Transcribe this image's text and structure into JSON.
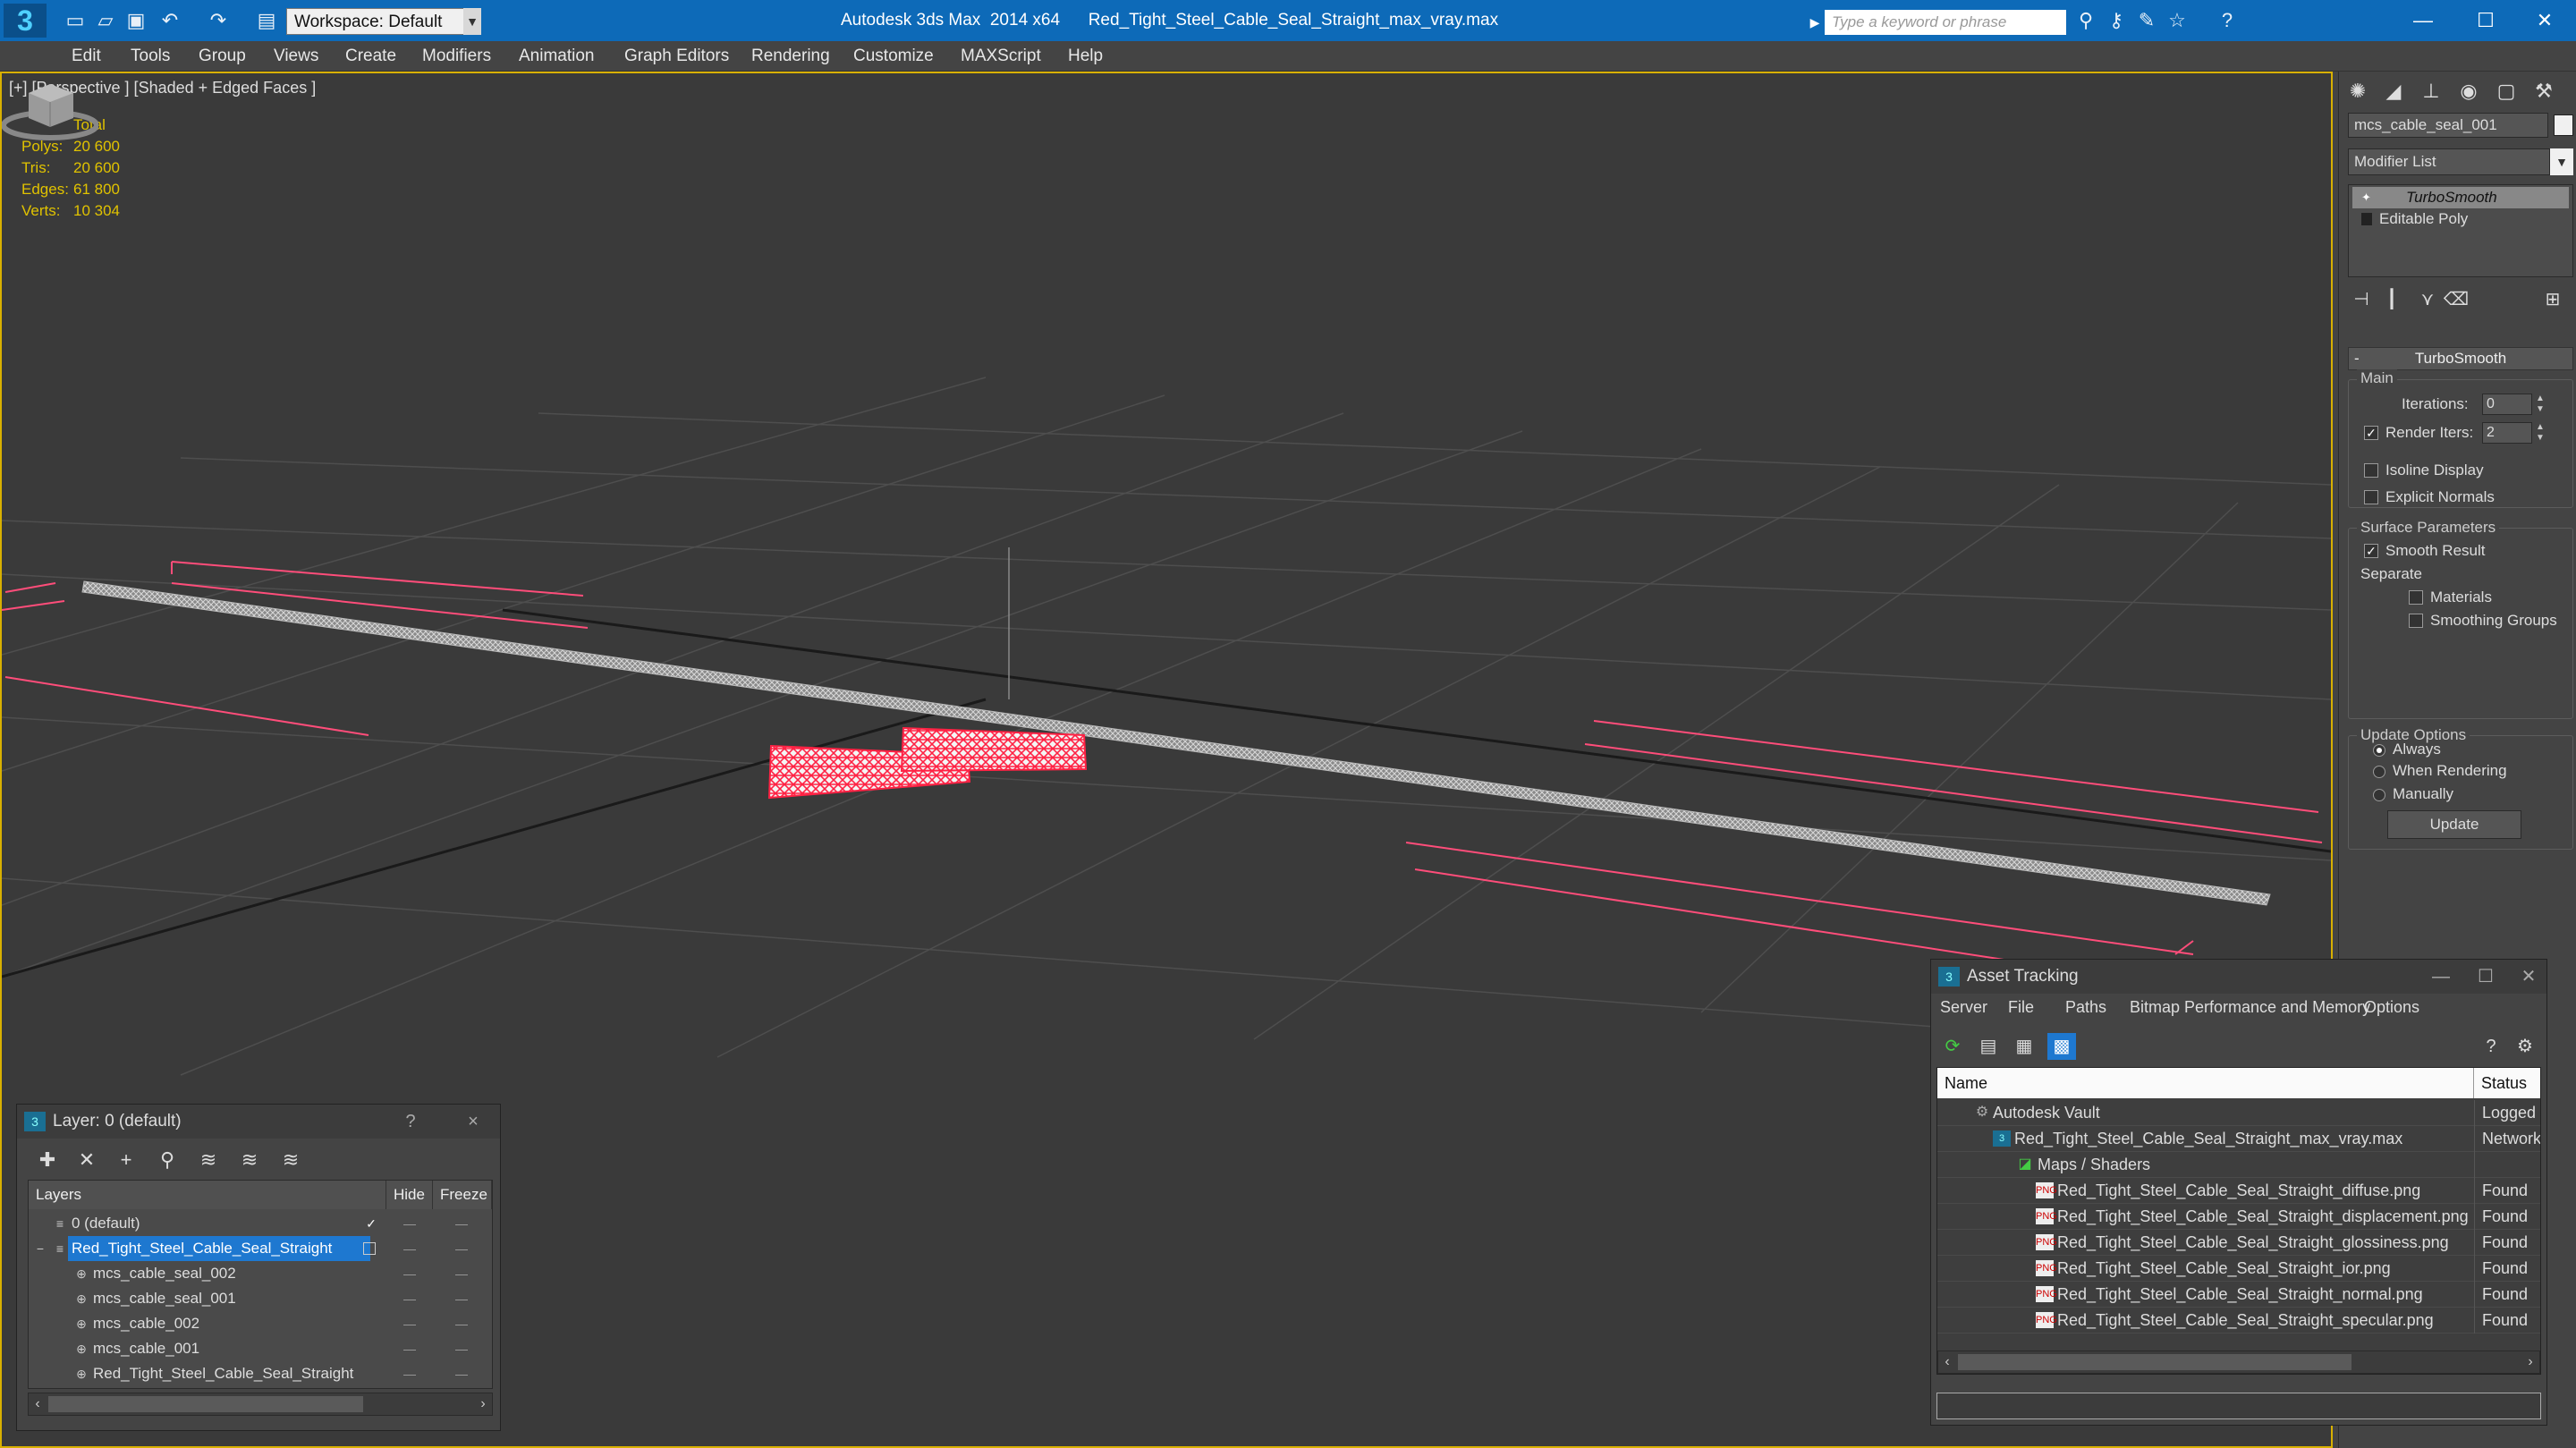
{
  "titlebar": {
    "app_title": "Autodesk 3ds Max  2014 x64      Red_Tight_Steel_Cable_Seal_Straight_max_vray.max",
    "workspace": "Workspace: Default",
    "search_placeholder": "Type a keyword or phrase",
    "logo": "3"
  },
  "menu": {
    "items": [
      "Edit",
      "Tools",
      "Group",
      "Views",
      "Create",
      "Modifiers",
      "Animation",
      "Graph Editors",
      "Rendering",
      "Customize",
      "MAXScript",
      "Help"
    ]
  },
  "viewport": {
    "label": "[+] [Perspective ] [Shaded + Edged Faces ]",
    "stats": {
      "header": "Total",
      "rows": [
        {
          "label": "Polys:",
          "value": "20 600"
        },
        {
          "label": "Tris:",
          "value": "20 600"
        },
        {
          "label": "Edges:",
          "value": "61 800"
        },
        {
          "label": "Verts:",
          "value": "10 304"
        }
      ]
    },
    "colors": {
      "selection": "#e0c200",
      "wire": "#ff3355",
      "grid": "#505050"
    }
  },
  "command_panel": {
    "object_name": "mcs_cable_seal_001",
    "modifier_list": "Modifier List",
    "stack": [
      "TurboSmooth",
      "Editable Poly"
    ],
    "rollout_title": "TurboSmooth",
    "main_group": "Main",
    "iterations_label": "Iterations:",
    "iterations_value": "0",
    "render_iters_label": "Render Iters:",
    "render_iters_value": "2",
    "render_iters_checked": true,
    "isoline_label": "Isoline Display",
    "explicit_normals_label": "Explicit Normals",
    "surface_group": "Surface Parameters",
    "smooth_result_label": "Smooth Result",
    "separate_label": "Separate",
    "materials_label": "Materials",
    "smoothing_groups_label": "Smoothing Groups",
    "update_group": "Update Options",
    "update_options": [
      "Always",
      "When Rendering",
      "Manually"
    ],
    "update_selected": "Always",
    "update_button": "Update"
  },
  "layer_dialog": {
    "title": "Layer: 0 (default)",
    "help": "?",
    "close": "×",
    "columns": {
      "layers": "Layers",
      "hide": "Hide",
      "freeze": "Freeze"
    },
    "rows": [
      {
        "name": "0 (default)",
        "indent": 0,
        "kind": "layer",
        "active": true
      },
      {
        "name": "Red_Tight_Steel_Cable_Seal_Straight",
        "indent": 0,
        "kind": "layer",
        "selected": true
      },
      {
        "name": "mcs_cable_seal_002",
        "indent": 1,
        "kind": "object"
      },
      {
        "name": "mcs_cable_seal_001",
        "indent": 1,
        "kind": "object"
      },
      {
        "name": "mcs_cable_002",
        "indent": 1,
        "kind": "object"
      },
      {
        "name": "mcs_cable_001",
        "indent": 1,
        "kind": "object"
      },
      {
        "name": "Red_Tight_Steel_Cable_Seal_Straight",
        "indent": 1,
        "kind": "object"
      }
    ]
  },
  "asset_dialog": {
    "title": "Asset Tracking",
    "menu": [
      "Server",
      "File",
      "Paths",
      "Bitmap Performance and Memory",
      "Options"
    ],
    "columns": {
      "name": "Name",
      "status": "Status"
    },
    "rows": [
      {
        "name": "Autodesk Vault",
        "indent": 1,
        "status": "Logged O",
        "kind": "vault"
      },
      {
        "name": "Red_Tight_Steel_Cable_Seal_Straight_max_vray.max",
        "indent": 2,
        "status": "Network F",
        "kind": "max"
      },
      {
        "name": "Maps / Shaders",
        "indent": 3,
        "status": "",
        "kind": "folder"
      },
      {
        "name": "Red_Tight_Steel_Cable_Seal_Straight_diffuse.png",
        "indent": 4,
        "status": "Found",
        "kind": "png"
      },
      {
        "name": "Red_Tight_Steel_Cable_Seal_Straight_displacement.png",
        "indent": 4,
        "status": "Found",
        "kind": "png"
      },
      {
        "name": "Red_Tight_Steel_Cable_Seal_Straight_glossiness.png",
        "indent": 4,
        "status": "Found",
        "kind": "png"
      },
      {
        "name": "Red_Tight_Steel_Cable_Seal_Straight_ior.png",
        "indent": 4,
        "status": "Found",
        "kind": "png"
      },
      {
        "name": "Red_Tight_Steel_Cable_Seal_Straight_normal.png",
        "indent": 4,
        "status": "Found",
        "kind": "png"
      },
      {
        "name": "Red_Tight_Steel_Cable_Seal_Straight_specular.png",
        "indent": 4,
        "status": "Found",
        "kind": "png"
      }
    ]
  }
}
